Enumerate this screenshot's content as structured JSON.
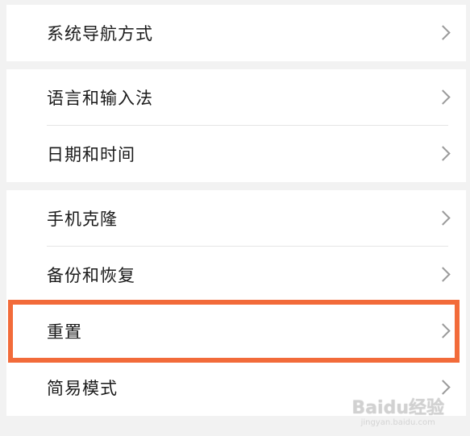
{
  "settings": {
    "group1": [
      {
        "label": "系统导航方式"
      }
    ],
    "group2": [
      {
        "label": "语言和输入法"
      },
      {
        "label": "日期和时间"
      }
    ],
    "group3": [
      {
        "label": "手机克隆"
      },
      {
        "label": "备份和恢复"
      },
      {
        "label": "重置"
      },
      {
        "label": "简易模式"
      }
    ]
  },
  "highlight_color": "#f26b3a",
  "icons": {
    "chevron": "chevron-right-icon"
  },
  "watermark": {
    "main": "Baidu经验",
    "sub": "jingyan.baidu.com"
  }
}
